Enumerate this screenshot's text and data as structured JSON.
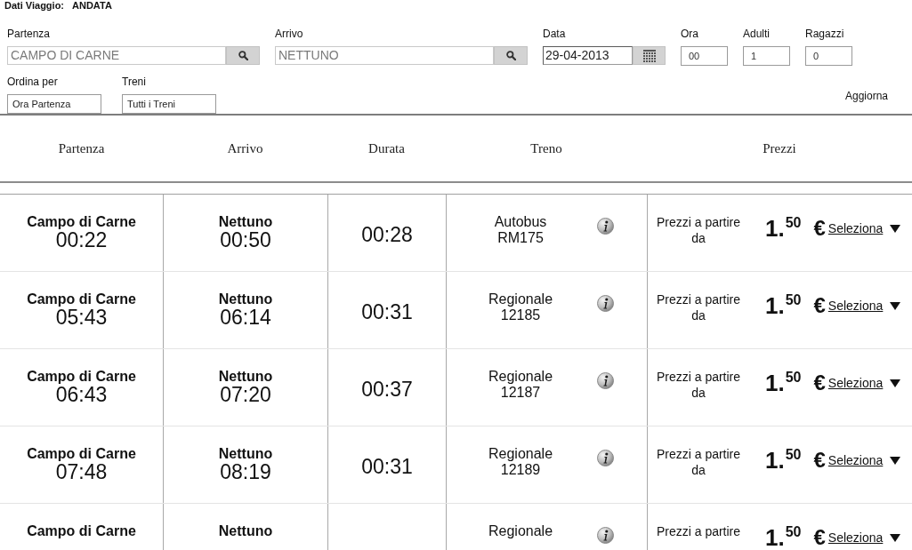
{
  "trip_header": {
    "label": "Dati Viaggio:",
    "value": "ANDATA"
  },
  "search_form": {
    "fields": [
      {
        "kind": "station",
        "label": "Partenza",
        "value": "CAMPO DI CARNE"
      },
      {
        "kind": "station",
        "label": "Arrivo",
        "value": "NETTUNO"
      },
      {
        "kind": "date",
        "label": "Data",
        "value": "29-04-2013"
      },
      {
        "kind": "small",
        "label": "Ora",
        "value": "00"
      },
      {
        "kind": "small",
        "label": "Adulti",
        "value": "1"
      },
      {
        "kind": "small",
        "label": "Ragazzi",
        "value": "0"
      }
    ],
    "filters": [
      {
        "label": "Ordina per",
        "value": "Ora Partenza"
      },
      {
        "label": "Treni",
        "value": "Tutti i Treni"
      }
    ],
    "update_link": "Aggiorna"
  },
  "table": {
    "columns": [
      "Partenza",
      "Arrivo",
      "Durata",
      "Treno",
      "Prezzi"
    ],
    "rows": [
      {
        "departure_station": "Campo di Carne",
        "departure_time": "00:22",
        "arrival_station": "Nettuno",
        "arrival_time": "00:50",
        "duration": "00:28",
        "train_type": "Autobus",
        "train_number": "RM175",
        "price_note": "Prezzi a partire da",
        "price": "1.$^{50}$",
        "currency": "€",
        "action": "Seleziona"
      },
      {
        "departure_station": "Campo di Carne",
        "departure_time": "05:43",
        "arrival_station": "Nettuno",
        "arrival_time": "06:14",
        "duration": "00:31",
        "train_type": "Regionale",
        "train_number": "12185",
        "price_note": "Prezzi a partire da",
        "price": "1.$^{50}$",
        "currency": "€",
        "action": "Seleziona"
      },
      {
        "departure_station": "Campo di Carne",
        "departure_time": "06:43",
        "arrival_station": "Nettuno",
        "arrival_time": "07:20",
        "duration": "00:37",
        "train_type": "Regionale",
        "train_number": "12187",
        "price_note": "Prezzi a partire da",
        "price": "1.$^{50}$",
        "currency": "€",
        "action": "Seleziona"
      },
      {
        "departure_station": "Campo di Carne",
        "departure_time": "07:48",
        "arrival_station": "Nettuno",
        "arrival_time": "08:19",
        "duration": "00:31",
        "train_type": "Regionale",
        "train_number": "12189",
        "price_note": "Prezzi a partire da",
        "price": "1.$^{50}$",
        "currency": "€",
        "action": "Seleziona"
      },
      {
        "departure_station": "Campo di Carne",
        "arrival_station": "Nettuno",
        "train_type": "Regionale",
        "price_note": "Prezzi a partire",
        "price": "1.$^{50}$",
        "currency": "€",
        "action": "Seleziona"
      }
    ]
  }
}
